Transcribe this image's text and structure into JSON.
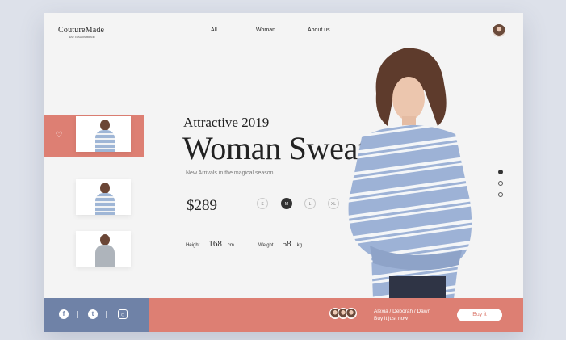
{
  "brand": {
    "name": "CoutureMade",
    "tagline": "EST. FASHION BRAND"
  },
  "nav": {
    "items": [
      "All",
      "Woman",
      "About us"
    ]
  },
  "hero": {
    "kicker": "Attractive 2019",
    "title": "Woman Sweater",
    "subtitle": "New Arrivals in  the magical season",
    "price": "$289",
    "sizes": [
      "S",
      "M",
      "L",
      "XL"
    ],
    "selected_size": "M",
    "height": {
      "label": "Height",
      "value": "168",
      "unit": "cm"
    },
    "weight": {
      "label": "Weight",
      "value": "58",
      "unit": "kg"
    }
  },
  "footer": {
    "social": [
      "facebook-icon",
      "twitter-icon",
      "instagram-icon"
    ],
    "stylists_line1": "Alexia / Deborah / Dawn",
    "stylists_line2": "Buy it  just  now",
    "buy_label": "Buy it"
  },
  "colors": {
    "accent": "#dd7f73",
    "footer_blue": "#6f82a7",
    "background": "#f4f4f4"
  }
}
